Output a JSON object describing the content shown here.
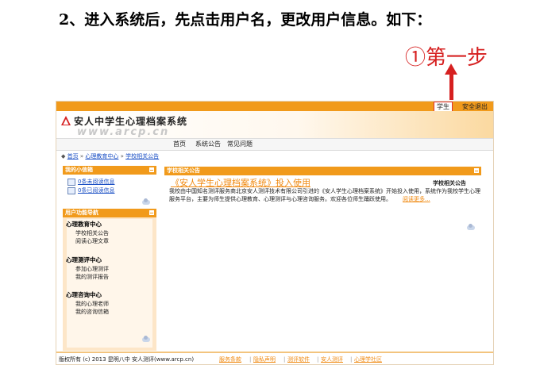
{
  "doc": {
    "heading": "2、进入系统后，先点击用户名，更改用户信息。如下：",
    "step_label": "①第一步"
  },
  "app": {
    "top_links": {
      "user": "学生",
      "logout": "安全退出"
    },
    "system_title": "安人中学生心理档案系统",
    "site_url": "www.arcp.cn",
    "nav": [
      "首页",
      "系统公告",
      "常见问题"
    ],
    "breadcrumb": [
      "首页",
      "心理教育中心",
      "学校相关公告"
    ],
    "messages_box": {
      "title": "我的小信箱",
      "items": [
        "0条未阅读信息",
        "0条已阅读信息"
      ]
    },
    "function_nav": {
      "title": "用户功能导航",
      "groups": [
        {
          "title": "心理教育中心",
          "items": [
            "学校相关公告",
            "阅读心理文章"
          ]
        },
        {
          "title": "心理测评中心",
          "items": [
            "参加心理测评",
            "我的测评报告"
          ]
        },
        {
          "title": "心理咨询中心",
          "items": [
            "我的心理老师",
            "我的咨询信箱"
          ]
        }
      ]
    },
    "notice": {
      "panel_title": "学校相关公告",
      "title": "《安人学生心理档案系统》投入使用",
      "tag": "学校相关公告",
      "body": "我校由中国知名测评服务商北京安人测评技术有限公司引进的《安人学生心理档案系统》开始投入使用，系统作为我校学生心理服务平台，主要为师生提供心理教育、心理测评与心理咨询服务。欢迎各位师生踊跃使用。",
      "read_more": "阅读更多..."
    },
    "footer": {
      "copyright": "版权所有 (c) 2013 昆明八中 安人测评(www.arcp.cn)",
      "links": [
        "服务条款",
        "隐私声明",
        "测评软件",
        "安人测评",
        "心理学社区"
      ]
    },
    "colors": {
      "accent": "#f19a1b",
      "link_orange": "#f08a12",
      "link_blue": "#1a4fc4",
      "highlight_red": "#d62020"
    }
  }
}
